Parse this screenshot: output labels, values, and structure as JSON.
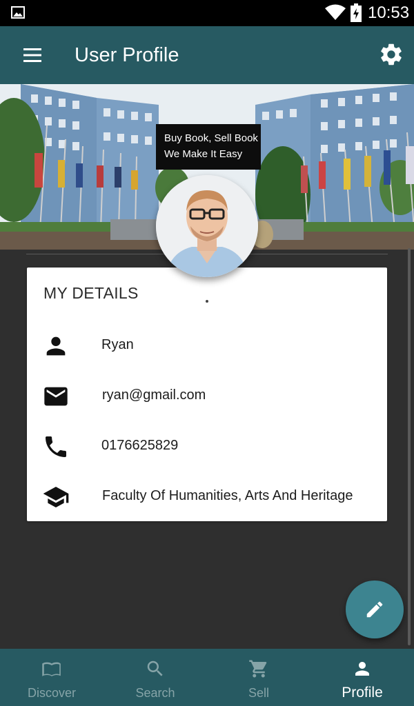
{
  "status_bar": {
    "time": "10:53",
    "icons": [
      "image-icon",
      "wifi-icon",
      "battery-charging-icon"
    ]
  },
  "app_bar": {
    "title": "User Profile",
    "menu_icon": "menu-icon",
    "settings_icon": "gear-icon"
  },
  "banner": {
    "tagline_line1": "Buy Book, Sell Book",
    "tagline_line2": "We Make It Easy"
  },
  "details": {
    "heading": "MY DETAILS",
    "rows": [
      {
        "icon": "person-icon",
        "value": "Ryan"
      },
      {
        "icon": "mail-icon",
        "value": "ryan@gmail.com"
      },
      {
        "icon": "phone-icon",
        "value": "0176625829"
      },
      {
        "icon": "graduation-cap-icon",
        "value": "Faculty Of Humanities, Arts And Heritage"
      }
    ]
  },
  "fab": {
    "icon": "pencil-icon"
  },
  "bottom_nav": {
    "items": [
      {
        "label": "Discover",
        "icon": "book-icon",
        "active": false
      },
      {
        "label": "Search",
        "icon": "search-icon",
        "active": false
      },
      {
        "label": "Sell",
        "icon": "cart-icon",
        "active": false
      },
      {
        "label": "Profile",
        "icon": "person-icon",
        "active": true
      }
    ]
  },
  "colors": {
    "primary": "#275a62",
    "accent": "#3d8490",
    "background": "#2f2f2f",
    "inactive_nav": "#86a4a8"
  }
}
